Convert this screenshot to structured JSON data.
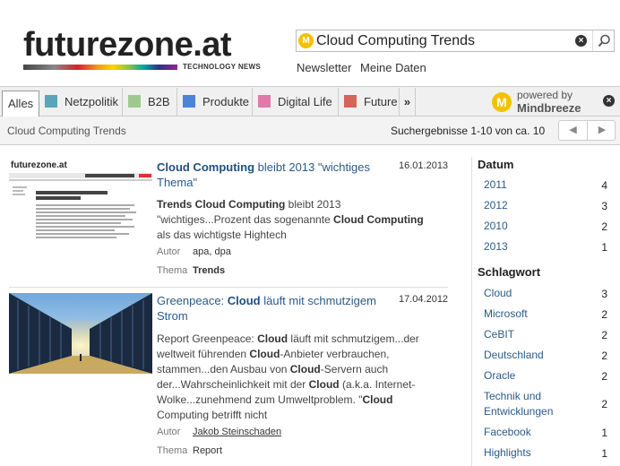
{
  "header": {
    "logo_text": "futurezone.at",
    "logo_sub": "TECHNOLOGY NEWS",
    "search": {
      "value": "Cloud Computing Trends",
      "icon": "mindbreeze-m-icon"
    },
    "links": [
      "Newsletter",
      "Meine Daten"
    ]
  },
  "tabs": {
    "items": [
      {
        "label": "Alles",
        "color": ""
      },
      {
        "label": "Netzpolitik",
        "color": "#5aa5b8"
      },
      {
        "label": "B2B",
        "color": "#9fca8f"
      },
      {
        "label": "Produkte",
        "color": "#4a86d8"
      },
      {
        "label": "Digital Life",
        "color": "#e07aa8"
      },
      {
        "label": "Future",
        "color": "#d6645a"
      }
    ],
    "more": "»",
    "powered_by": "powered by",
    "powered_name": "Mindbreeze"
  },
  "subbar": {
    "query": "Cloud Computing Trends",
    "count": "Suchergebnisse 1-10 von ca. 10",
    "prev": "◀",
    "next": "▶"
  },
  "results": [
    {
      "title_bold": "Cloud Computing",
      "title_rest": " bleibt 2013 \"wichtiges Thema\"",
      "date": "16.01.2013",
      "snippet_html": "<b>Trends Cloud Computing</b> bleibt 2013 \"wichtiges...Prozent das sogenannte <b>Cloud Computing</b> als das wichtigste Hightech",
      "author_label": "Autor",
      "author": "apa, dpa",
      "topic_label": "Thema",
      "topic": "Trends",
      "thumb_logo": "futurezone.at",
      "thumb_headline": "Cloud Computing bleibt 2013 \"wichtiges Thema\""
    },
    {
      "title_pre": "Greenpeace: ",
      "title_bold": "Cloud",
      "title_rest": " läuft mit schmutzigem Strom",
      "date": "17.04.2012",
      "snippet_html": "Report Greenpeace: <b>Cloud</b> läuft mit schmutzigem...der weltweit führenden <b>Cloud</b>-Anbieter verbrauchen, stammen...den Ausbau von <b>Cloud</b>-Servern auch der...Wahrscheinlichkeit mit der <b>Cloud</b> (a.k.a. Internet-Wolke...zunehmend zum Umweltproblem. \"<b>Cloud</b> Computing betrifft nicht",
      "author_label": "Autor",
      "author": "Jakob Steinschaden",
      "topic_label": "Thema",
      "topic": "Report"
    }
  ],
  "sidebar": {
    "datum_title": "Datum",
    "datum": [
      {
        "label": "2011",
        "count": "4"
      },
      {
        "label": "2012",
        "count": "3"
      },
      {
        "label": "2010",
        "count": "2"
      },
      {
        "label": "2013",
        "count": "1"
      }
    ],
    "schlagwort_title": "Schlagwort",
    "schlagwort": [
      {
        "label": "Cloud",
        "count": "3"
      },
      {
        "label": "Microsoft",
        "count": "2"
      },
      {
        "label": "CeBIT",
        "count": "2"
      },
      {
        "label": "Deutschland",
        "count": "2"
      },
      {
        "label": "Oracle",
        "count": "2"
      },
      {
        "label": "Technik und Entwicklungen",
        "count": "2"
      },
      {
        "label": "Facebook",
        "count": "1"
      },
      {
        "label": "Highlights",
        "count": "1"
      }
    ]
  }
}
